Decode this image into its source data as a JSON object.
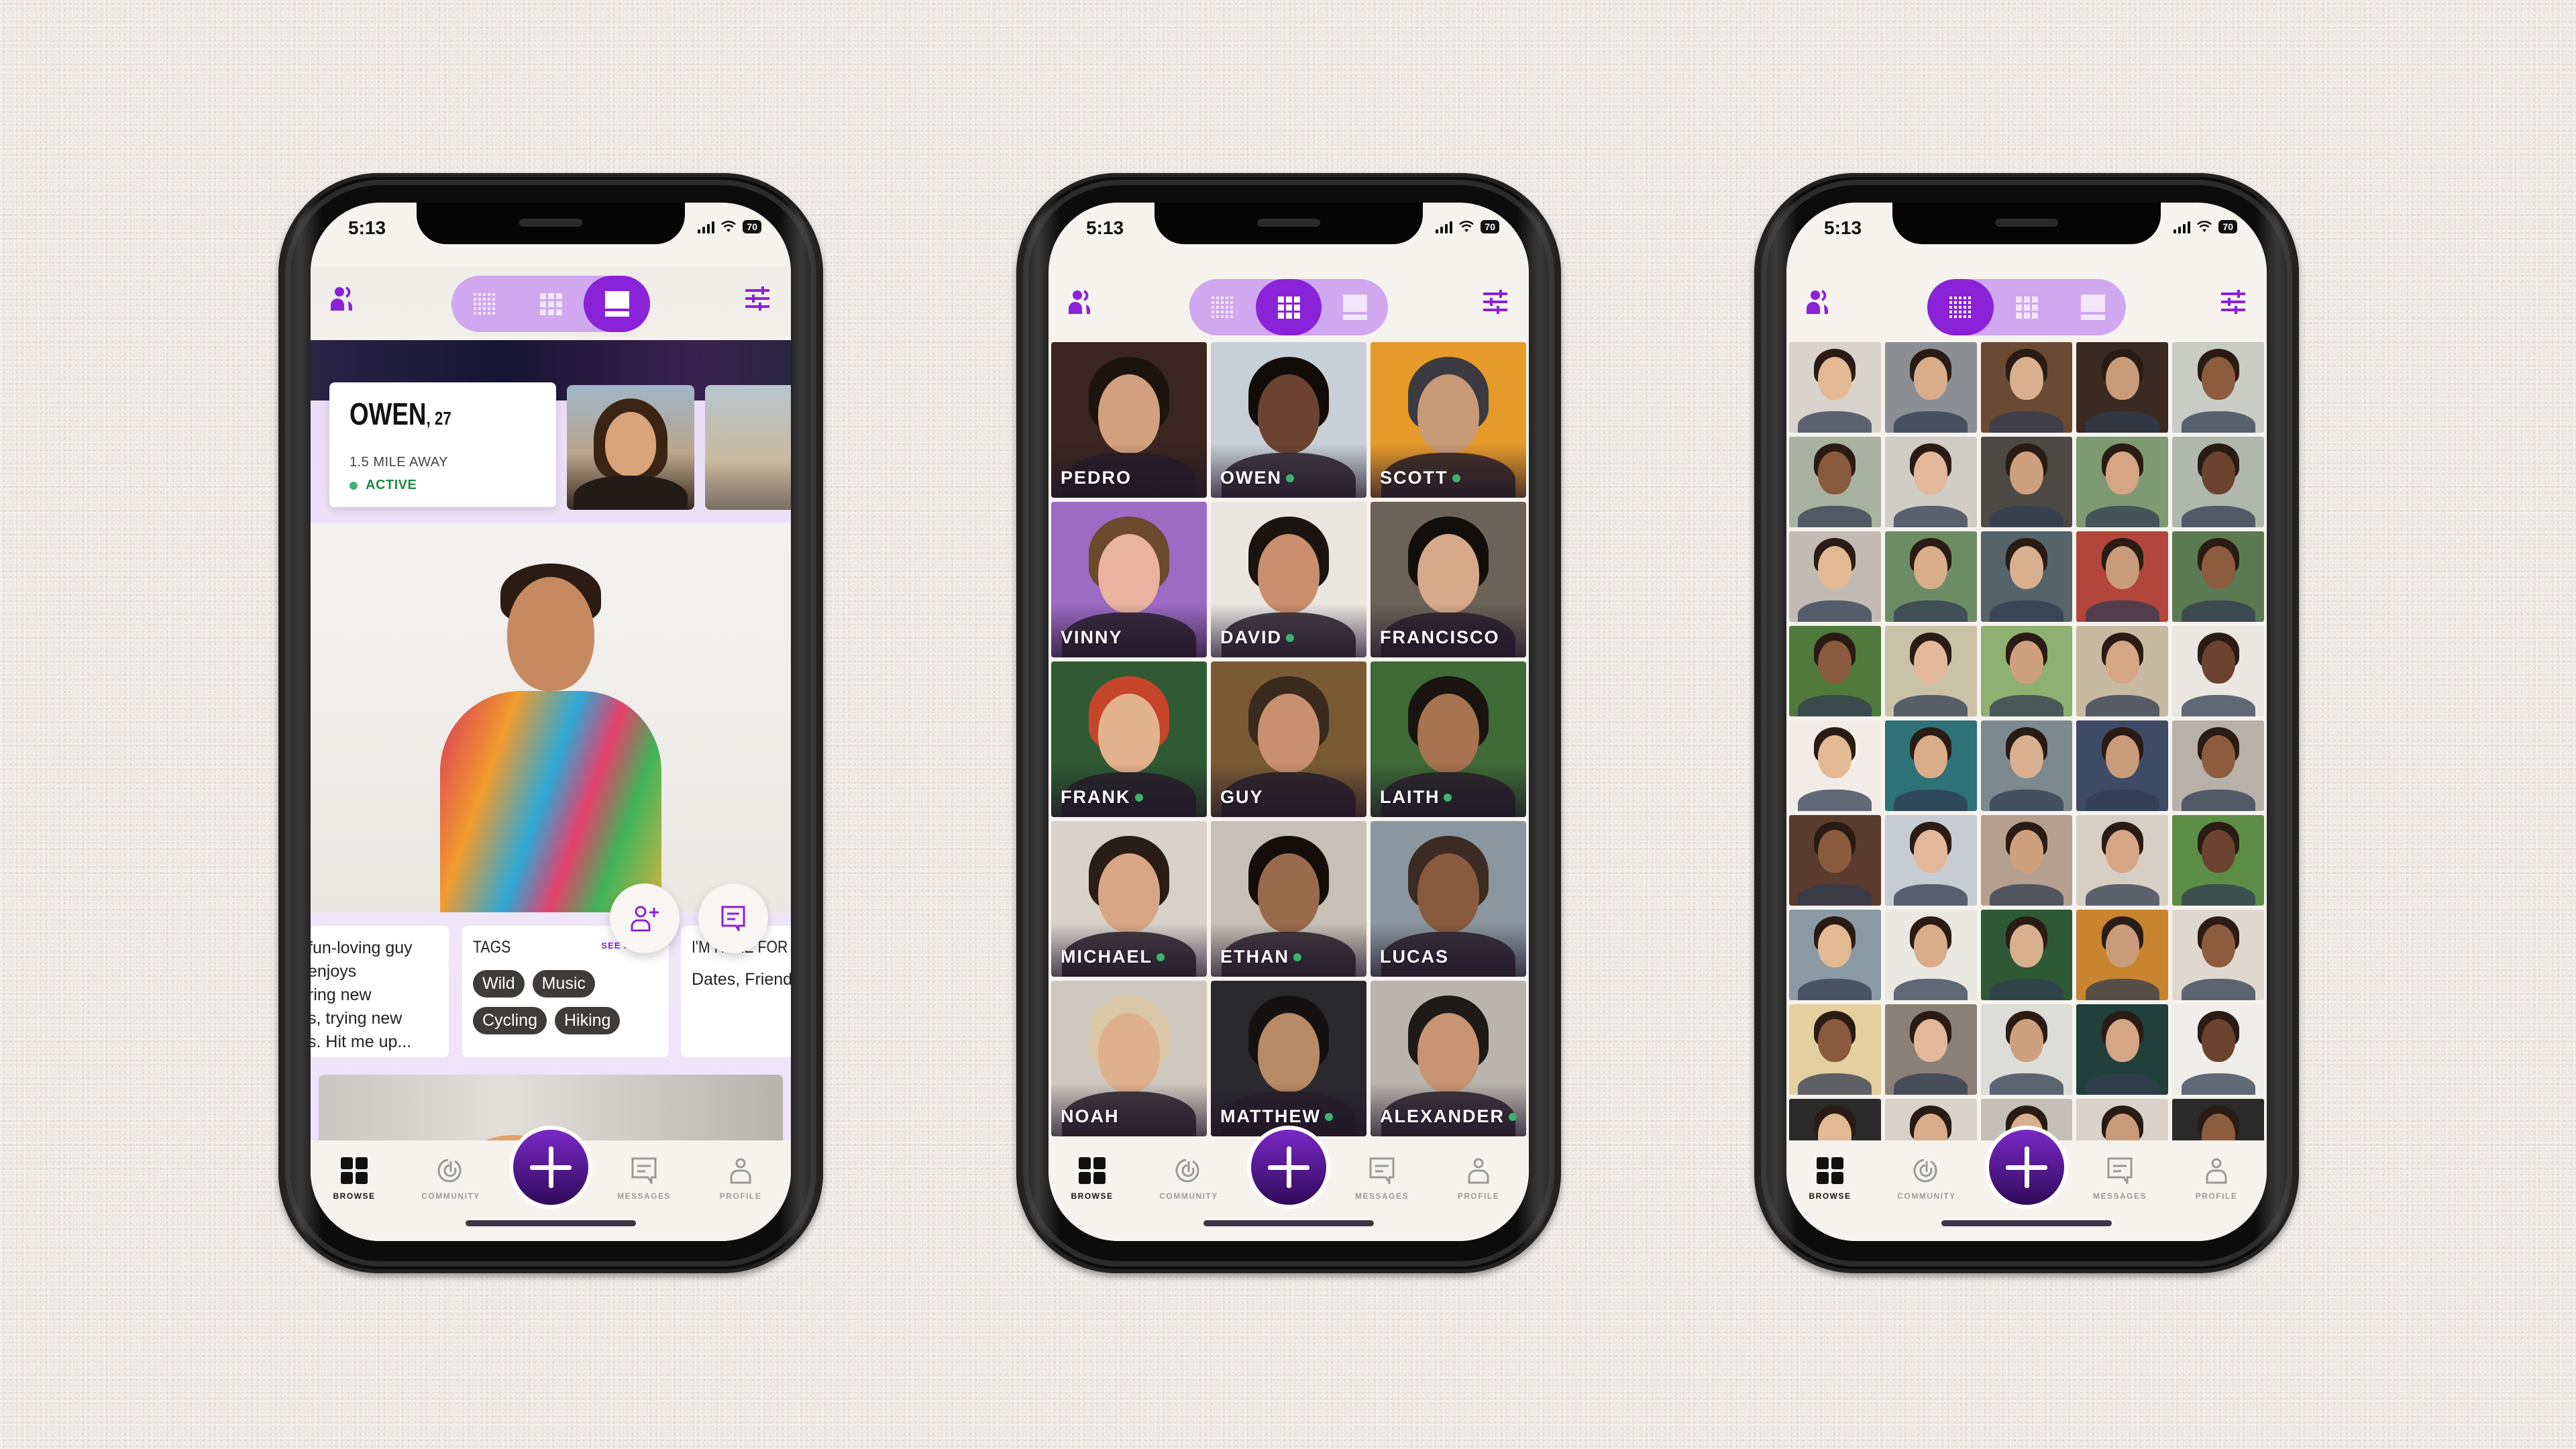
{
  "status_bar": {
    "time": "5:13",
    "battery": "70"
  },
  "nav": {
    "items": [
      {
        "label": "BROWSE",
        "icon": "browse-grid-icon",
        "active": true
      },
      {
        "label": "COMMUNITY",
        "icon": "community-icon",
        "active": false
      },
      {
        "label": "MESSAGES",
        "icon": "messages-icon",
        "active": false
      },
      {
        "label": "PROFILE",
        "icon": "profile-icon",
        "active": false
      }
    ],
    "center_action": "plus-icon"
  },
  "view_toggle": {
    "options": [
      "dense-grid",
      "grid",
      "single-profile"
    ],
    "phone1_selected": "single-profile",
    "phone2_selected": "grid",
    "phone3_selected": "dense-grid"
  },
  "colors": {
    "accent": "#8a22d8",
    "toggle_bg": "#cfa8ef",
    "active_green": "#3cb371",
    "active_text": "#1f8a45",
    "tag_bg": "#3f3b38"
  },
  "profile": {
    "name": "OWEN",
    "age_text": ", 27",
    "distance": "1.5 MILE AWAY",
    "status": "ACTIVE",
    "bio": "fun-loving guy\nenjoys\nring new\ns, trying new\ns. Hit me up...",
    "tags_header": "TAGS",
    "see_more": "SEE MORE ›",
    "tags": [
      "Wild",
      "Music",
      "Cycling",
      "Hiking"
    ],
    "here_for_header": "I'M HERE FOR",
    "here_for": "Dates, Friends"
  },
  "grid_profiles": [
    {
      "name": "PEDRO",
      "online": false
    },
    {
      "name": "OWEN",
      "online": true
    },
    {
      "name": "SCOTT",
      "online": true
    },
    {
      "name": "VINNY",
      "online": false
    },
    {
      "name": "DAVID",
      "online": true
    },
    {
      "name": "FRANCISCO",
      "online": false
    },
    {
      "name": "FRANK",
      "online": true
    },
    {
      "name": "GUY",
      "online": false
    },
    {
      "name": "LAITH",
      "online": true
    },
    {
      "name": "MICHAEL",
      "online": true
    },
    {
      "name": "ETHAN",
      "online": true
    },
    {
      "name": "LUCAS",
      "online": false
    },
    {
      "name": "NOAH",
      "online": false
    },
    {
      "name": "MATTHEW",
      "online": true
    },
    {
      "name": "ALEXANDER",
      "online": true
    }
  ],
  "dense_grid": {
    "columns": 5,
    "visible_rows": 9
  }
}
